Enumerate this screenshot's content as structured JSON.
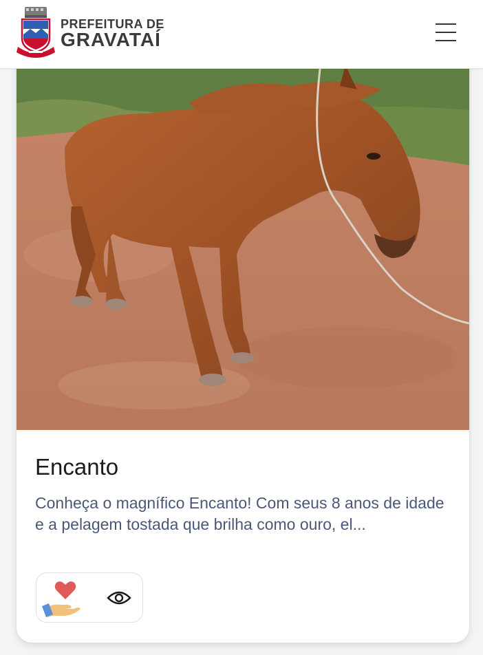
{
  "header": {
    "brand_line1": "PREFEITURA DE",
    "brand_line2": "GRAVATAÍ",
    "logo_icon": "city-coat-of-arms-icon",
    "menu_icon": "hamburger-menu-icon"
  },
  "card": {
    "photo_subject": "brown-horse-photo",
    "title": "Encanto",
    "description": "Conheça o magnífico Encanto! Com seus 8 anos de idade e a pelagem tostada que brilha como ouro, el...",
    "adopt_icon": "heart-hand-adopt-icon",
    "view_icon": "eye-icon"
  },
  "colors": {
    "brand_text": "#3a3a3a",
    "description_text": "#4a5878",
    "heart": "#e05a5a",
    "hand": "#f2c27a"
  }
}
